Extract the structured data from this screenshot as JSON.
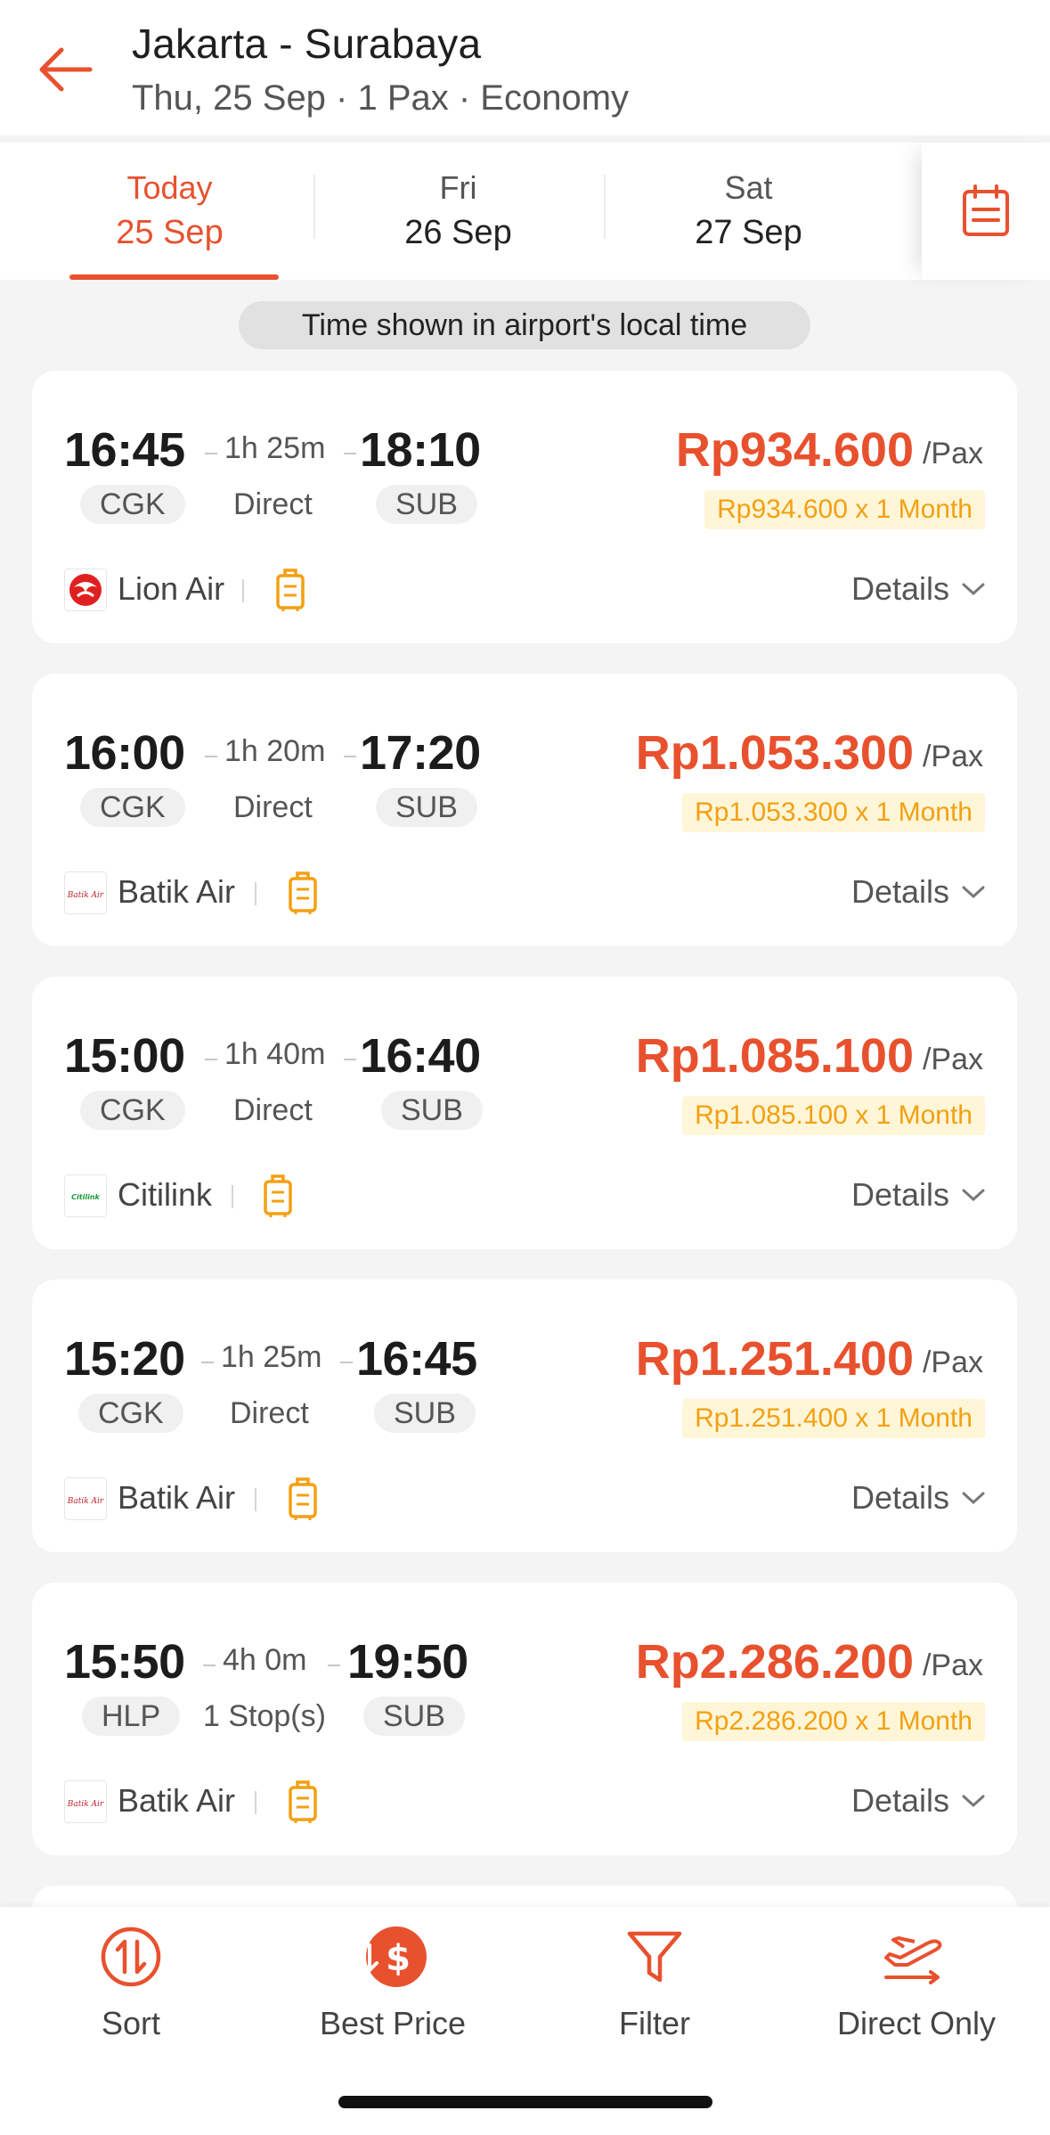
{
  "header": {
    "title": "Jakarta - Surabaya",
    "subtitle": "Thu, 25 Sep · 1 Pax · Economy"
  },
  "dates": [
    {
      "day": "Today",
      "date": "25 Sep",
      "active": true
    },
    {
      "day": "Fri",
      "date": "26 Sep",
      "active": false
    },
    {
      "day": "Sat",
      "date": "27 Sep",
      "active": false
    }
  ],
  "notice": "Time shown in airport's local time",
  "flights": [
    {
      "dep_time": "16:45",
      "duration": "1h 25m",
      "arr_time": "18:10",
      "dep_code": "CGK",
      "stops": "Direct",
      "arr_code": "SUB",
      "price": "Rp934.600",
      "per": "/Pax",
      "installment": "Rp934.600 x 1 Month",
      "airline": "Lion Air",
      "details": "Details"
    },
    {
      "dep_time": "16:00",
      "duration": "1h 20m",
      "arr_time": "17:20",
      "dep_code": "CGK",
      "stops": "Direct",
      "arr_code": "SUB",
      "price": "Rp1.053.300",
      "per": "/Pax",
      "installment": "Rp1.053.300 x 1 Month",
      "airline": "Batik Air",
      "details": "Details"
    },
    {
      "dep_time": "15:00",
      "duration": "1h 40m",
      "arr_time": "16:40",
      "dep_code": "CGK",
      "stops": "Direct",
      "arr_code": "SUB",
      "price": "Rp1.085.100",
      "per": "/Pax",
      "installment": "Rp1.085.100 x 1 Month",
      "airline": "Citilink",
      "details": "Details"
    },
    {
      "dep_time": "15:20",
      "duration": "1h 25m",
      "arr_time": "16:45",
      "dep_code": "CGK",
      "stops": "Direct",
      "arr_code": "SUB",
      "price": "Rp1.251.400",
      "per": "/Pax",
      "installment": "Rp1.251.400 x 1 Month",
      "airline": "Batik Air",
      "details": "Details"
    },
    {
      "dep_time": "15:50",
      "duration": "4h 0m",
      "arr_time": "19:50",
      "dep_code": "HLP",
      "stops": "1 Stop(s)",
      "arr_code": "SUB",
      "price": "Rp2.286.200",
      "per": "/Pax",
      "installment": "Rp2.286.200 x 1 Month",
      "airline": "Batik Air",
      "details": "Details"
    }
  ],
  "airline_logos": {
    "Batik Air": "Batik Air",
    "Citilink": "Citilink"
  },
  "bottom_bar": {
    "sort": "Sort",
    "best_price": "Best Price",
    "filter": "Filter",
    "direct_only": "Direct Only"
  },
  "colors": {
    "accent": "#e8512e",
    "installment_text": "#f3a012",
    "installment_bg": "#fff6d8"
  }
}
